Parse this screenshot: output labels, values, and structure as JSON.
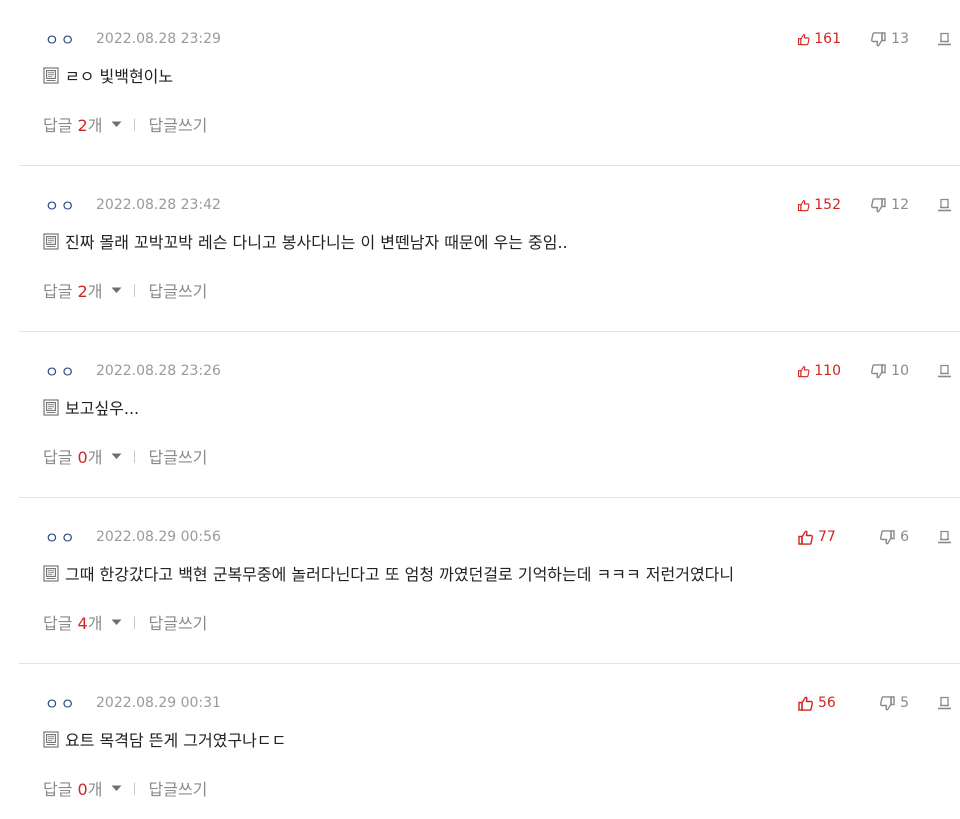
{
  "comments": [
    {
      "nickname": "ㅇㅇ",
      "date": "2022.08.28 23:29",
      "text": "ㄹㅇ 빛백현이노",
      "likes": "161",
      "dislikes": "13",
      "reply_label": "답글",
      "reply_count": "2",
      "reply_unit": "개",
      "separator": "|",
      "write_reply": "답글쓰기"
    },
    {
      "nickname": "ㅇㅇ",
      "date": "2022.08.28 23:42",
      "text": "진짜 몰래 꼬박꼬박 레슨 다니고 봉사다니는 이 변뗀남자 때문에 우는 중임..",
      "likes": "152",
      "dislikes": "12",
      "reply_label": "답글",
      "reply_count": "2",
      "reply_unit": "개",
      "separator": "|",
      "write_reply": "답글쓰기"
    },
    {
      "nickname": "ㅇㅇ",
      "date": "2022.08.28 23:26",
      "text": "보고싶우...",
      "likes": "110",
      "dislikes": "10",
      "reply_label": "답글",
      "reply_count": "0",
      "reply_unit": "개",
      "separator": "|",
      "write_reply": "답글쓰기"
    },
    {
      "nickname": "ㅇㅇ",
      "date": "2022.08.29 00:56",
      "text": "그때 한강갔다고 백현 군복무중에 놀러다닌다고 또 엄청 까였던걸로 기억하는데 ㅋㅋㅋ 저런거였다니",
      "likes": "77",
      "dislikes": "6",
      "reply_label": "답글",
      "reply_count": "4",
      "reply_unit": "개",
      "separator": "|",
      "write_reply": "답글쓰기"
    },
    {
      "nickname": "ㅇㅇ",
      "date": "2022.08.29 00:31",
      "text": "요트 목격담 뜬게 그거였구나ㄷㄷ",
      "likes": "56",
      "dislikes": "5",
      "reply_label": "답글",
      "reply_count": "0",
      "reply_unit": "개",
      "separator": "|",
      "write_reply": "답글쓰기"
    }
  ],
  "colors": {
    "nickname": "#2c4a8a",
    "like": "#d0261f",
    "muted": "#8a8a8a",
    "divider": "#e2e2e2"
  },
  "icons": {
    "memo": "memo-icon",
    "like": "thumbs-up-icon",
    "dislike": "thumbs-down-icon",
    "report": "report-icon",
    "caret": "caret-down-icon"
  }
}
